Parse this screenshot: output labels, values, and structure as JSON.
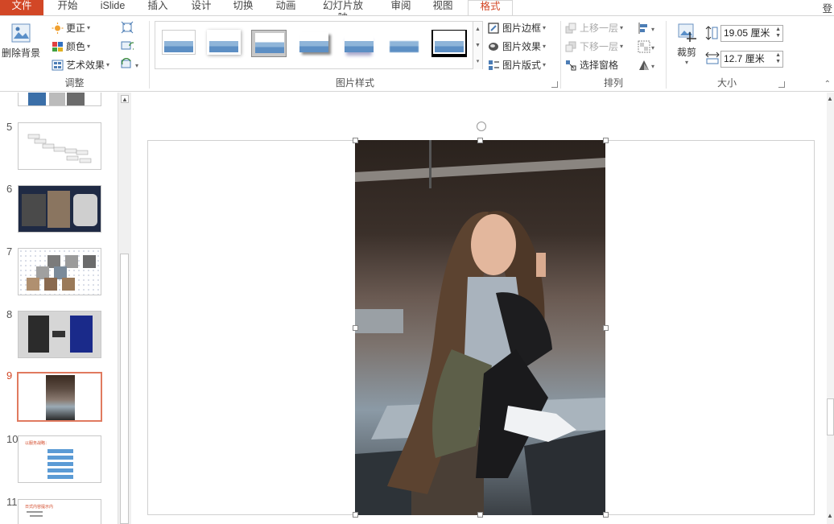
{
  "tabs": {
    "file": "文件",
    "items": [
      "开始",
      "iSlide",
      "插入",
      "设计",
      "切换",
      "动画",
      "幻灯片放映",
      "审阅",
      "视图"
    ],
    "active": "格式",
    "right": "登"
  },
  "ribbon": {
    "adjust": {
      "remove_bg": "删除背景",
      "correct": "更正",
      "color": "颜色",
      "art": "艺术效果",
      "label": "调整"
    },
    "picture_styles": {
      "border": "图片边框",
      "effect": "图片效果",
      "layout": "图片版式",
      "label": "图片样式"
    },
    "arrange": {
      "bring_forward": "上移一层",
      "send_backward": "下移一层",
      "selection_pane": "选择窗格",
      "label": "排列"
    },
    "size": {
      "crop": "裁剪",
      "height": "19.05 厘米",
      "width": "12.7 厘米",
      "label": "大小"
    }
  },
  "slides": {
    "numbers": [
      "5",
      "6",
      "7",
      "8",
      "9",
      "10",
      "11"
    ],
    "active": "9",
    "slide10_title": "以服务战略：",
    "slide11_title": "日式内容提示内"
  },
  "colors": {
    "accent": "#d24726",
    "thumb_active_border": "#e07a5f"
  }
}
